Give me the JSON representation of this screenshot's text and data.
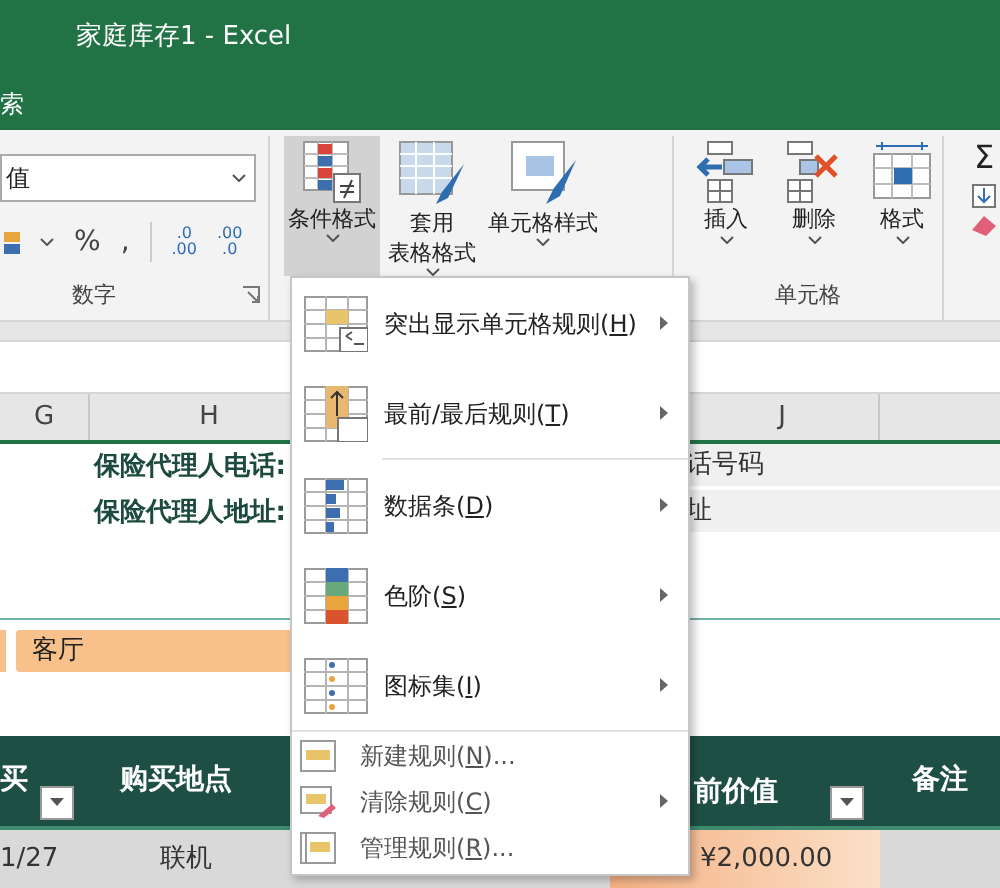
{
  "window": {
    "title": "家庭库存1 - Excel"
  },
  "tell_me": {
    "text": "索"
  },
  "ribbon": {
    "number_format": {
      "value": "值"
    },
    "number_symbols": [
      "%",
      ","
    ],
    "increase_decimal": [
      ".0",
      ".00"
    ],
    "decrease_decimal": [
      ".00",
      ".0"
    ],
    "number_group_label": "数字",
    "style_buttons": [
      {
        "kind": "conditional",
        "lines": [
          "条件格式"
        ],
        "selected": true
      },
      {
        "kind": "table",
        "lines": [
          "套用",
          "表格格式"
        ],
        "selected": false
      },
      {
        "kind": "cellstyle",
        "lines": [
          "单元格样式"
        ],
        "selected": false
      }
    ],
    "cell_buttons": [
      {
        "kind": "insert",
        "label": "插入"
      },
      {
        "kind": "delete",
        "label": "删除"
      },
      {
        "kind": "format",
        "label": "格式"
      }
    ],
    "cells_group_label": "单元格",
    "sum_symbol": "Σ"
  },
  "sheet": {
    "columns": [
      {
        "label": "G"
      },
      {
        "label": "H"
      },
      {
        "label": "J"
      }
    ],
    "info_rows": [
      {
        "label": "保险代理人电话:",
        "value": "话号码"
      },
      {
        "label": "保险代理人地址:",
        "value": "址"
      }
    ],
    "room_tag": "客厅",
    "table_headers": [
      {
        "text": "买",
        "filter": true
      },
      {
        "text": "购买地点",
        "filter": false
      },
      {
        "text": "前价值",
        "filter": true
      },
      {
        "text": "备注",
        "filter": false
      }
    ],
    "first_row": [
      "1/27",
      "联机",
      "¥2,000.00"
    ]
  },
  "menu": {
    "items": [
      {
        "kind": "large",
        "text": "突出显示单元格规则(",
        "key": "H",
        "tail": ")",
        "submenu": true
      },
      {
        "kind": "large",
        "text": "最前/最后规则(",
        "key": "T",
        "tail": ")",
        "submenu": true
      },
      {
        "kind": "large",
        "text": "数据条(",
        "key": "D",
        "tail": ")",
        "submenu": true
      },
      {
        "kind": "large",
        "text": "色阶(",
        "key": "S",
        "tail": ")",
        "submenu": true
      },
      {
        "kind": "large",
        "text": "图标集(",
        "key": "I",
        "tail": ")",
        "submenu": true
      },
      {
        "kind": "small",
        "text": "新建规则(",
        "key": "N",
        "tail": ")...",
        "submenu": false
      },
      {
        "kind": "small",
        "text": "清除规则(",
        "key": "C",
        "tail": ")",
        "submenu": true
      },
      {
        "kind": "small",
        "text": "管理规则(",
        "key": "R",
        "tail": ")...",
        "submenu": false
      }
    ]
  }
}
